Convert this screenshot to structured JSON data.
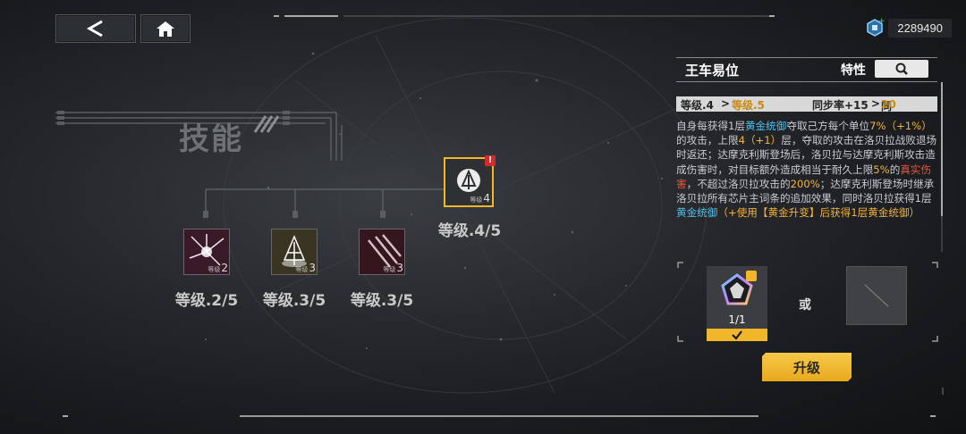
{
  "header": {
    "back_icon": "chevron-left-icon",
    "home_icon": "home-icon",
    "currency_icon": "chip-currency-icon",
    "currency_value": "2289490"
  },
  "skills_section": {
    "title": "技能",
    "skills": [
      {
        "icon": "light-burst-icon",
        "level_prefix": "等级",
        "level": "2",
        "caption_prefix": "等级.",
        "caption": "2/5",
        "tint": "#a02050"
      },
      {
        "icon": "tree-sigil-icon",
        "level_prefix": "等级",
        "level": "3",
        "caption_prefix": "等级.",
        "caption": "3/5",
        "tint": "#b08a30"
      },
      {
        "icon": "claw-slash-icon",
        "level_prefix": "等级",
        "level": "3",
        "caption_prefix": "等级.",
        "caption": "3/5",
        "tint": "#a02050"
      },
      {
        "icon": "crown-sigil-icon",
        "level_prefix": "等级",
        "level": "4",
        "caption_prefix": "等级.",
        "caption": "4/5",
        "tint": "#f1b62a",
        "selected": true,
        "alert": "!"
      }
    ]
  },
  "panel": {
    "title": "王车易位",
    "trait_label": "特性",
    "search_icon": "search-icon",
    "level_from": "等级.4",
    "arrow": ">",
    "level_to": "等级.5",
    "sync_from": "同步率+15",
    "sync_arrow": ">",
    "sync_to_prefix": "同步率+",
    "sync_to_value": "20",
    "description": {
      "p1": "自身每获得1层",
      "k1": "黄金统御",
      "p2": "夺取己方每个单位",
      "v1": "7%（+1%）",
      "p3": "的攻击，上限",
      "v2": "4（+1）",
      "p4": "层，夺取的攻击在洛贝拉战败退场时返还；达摩克利斯登场后，洛贝拉与达摩克利斯攻击造成伤害时，对目标额外造成相当于耐久上限",
      "v3": "5%",
      "p5": "的",
      "k2": "真实伤害",
      "p6": "，不超过洛贝拉攻击的",
      "v4": "200%",
      "p7": "；达摩克利斯登场时继承洛贝拉所有芯片主词条的追加效果，同时洛贝拉获得1层",
      "k3": "黄金统御",
      "p8": "（+使用【黄金升变】后获得1层黄金统御）"
    },
    "materials": {
      "item_icon": "core-chip-icon",
      "item_count": "1/1",
      "check_icon": "checkmark-icon",
      "or_label": "或",
      "alt_icon": "blank-material-icon"
    },
    "upgrade_label": "升级"
  },
  "colors": {
    "accent": "#f1b62a",
    "keyword": "#4fc2f0",
    "damage": "#e8553c"
  }
}
